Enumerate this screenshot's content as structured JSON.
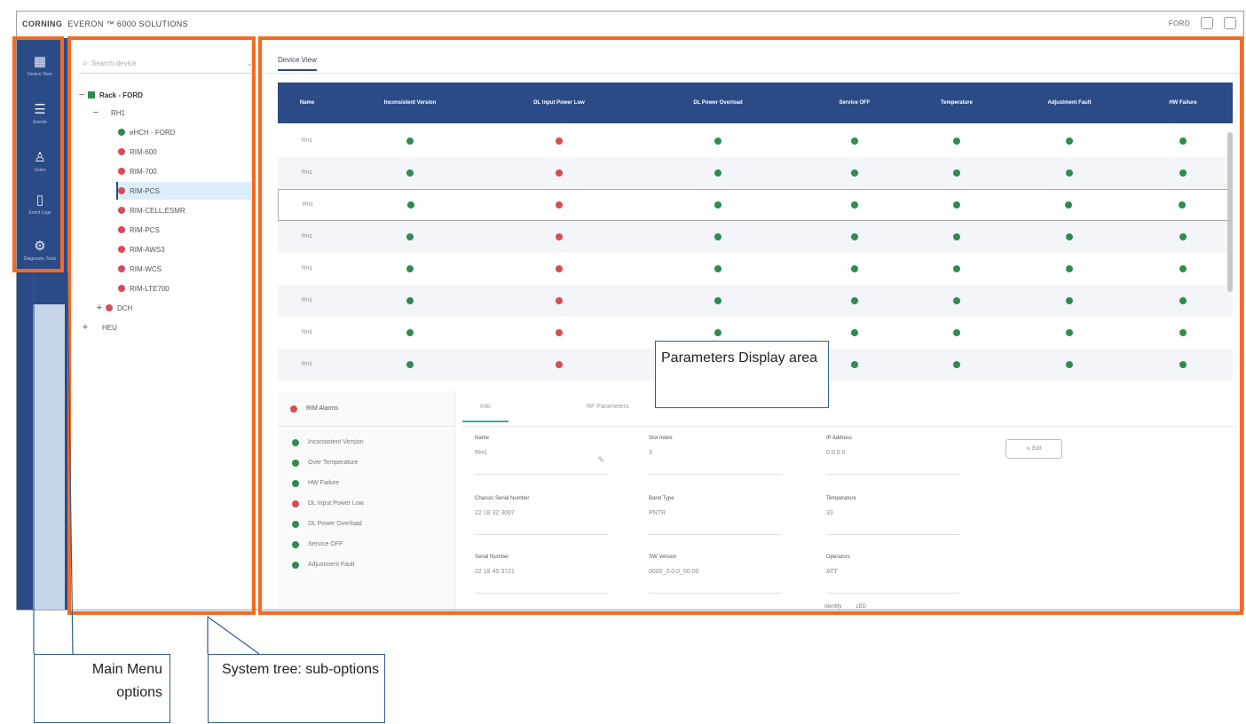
{
  "header": {
    "brand": "CORNING",
    "product": "EVERON ™ 6000 SOLUTIONS",
    "user": "FORD"
  },
  "menu": {
    "items": [
      {
        "label": "Device View",
        "icon": "grid-icon"
      },
      {
        "label": "Events",
        "icon": "list-icon"
      },
      {
        "label": "Users",
        "icon": "user-icon"
      },
      {
        "label": "Event Logs",
        "icon": "clipboard-icon"
      },
      {
        "label": "Diagnostic Tools",
        "icon": "gear-icon"
      }
    ]
  },
  "tree": {
    "search_placeholder": "Search device",
    "root": "Rack - FORD",
    "group": "RH1",
    "nodes": [
      {
        "label": "eHCH - FORD",
        "status": "ok"
      },
      {
        "label": "RIM-600",
        "status": "alarm"
      },
      {
        "label": "RIM-700",
        "status": "alarm"
      },
      {
        "label": "RIM-PCS",
        "status": "alarm"
      },
      {
        "label": "RIM-CELL,ESMR",
        "status": "alarm"
      },
      {
        "label": "RIM-PCS",
        "status": "alarm"
      },
      {
        "label": "RIM-AWS3",
        "status": "alarm"
      },
      {
        "label": "RIM-WCS",
        "status": "alarm"
      },
      {
        "label": "RIM-LTE700",
        "status": "alarm"
      }
    ],
    "dch": "DCH",
    "heu": "HEU"
  },
  "main": {
    "tab": "Device View",
    "columns": [
      "Name",
      "Inconsistent Version",
      "DL Input Power Low",
      "DL Power Overload",
      "Service OFF",
      "Temperature",
      "Adjustment Fault",
      "HW Failure"
    ],
    "rows": [
      {
        "name": "RH1",
        "status": [
          "ok",
          "alarm",
          "ok",
          "ok",
          "ok",
          "ok",
          "ok"
        ]
      },
      {
        "name": "RH1",
        "status": [
          "ok",
          "alarm",
          "ok",
          "ok",
          "ok",
          "ok",
          "ok"
        ]
      },
      {
        "name": "RH1",
        "status": [
          "ok",
          "alarm",
          "ok",
          "ok",
          "ok",
          "ok",
          "ok"
        ]
      },
      {
        "name": "RH1",
        "status": [
          "ok",
          "alarm",
          "ok",
          "ok",
          "ok",
          "ok",
          "ok"
        ]
      },
      {
        "name": "RH1",
        "status": [
          "ok",
          "alarm",
          "ok",
          "ok",
          "ok",
          "ok",
          "ok"
        ]
      },
      {
        "name": "RH1",
        "status": [
          "ok",
          "alarm",
          "ok",
          "ok",
          "ok",
          "ok",
          "ok"
        ]
      },
      {
        "name": "RH1",
        "status": [
          "ok",
          "alarm",
          "ok",
          "ok",
          "ok",
          "ok",
          "ok"
        ]
      },
      {
        "name": "RH1",
        "status": [
          "ok",
          "alarm",
          "ok",
          "ok",
          "ok",
          "ok",
          "ok"
        ]
      }
    ]
  },
  "alarms": {
    "title": "RIM Alarms",
    "items": [
      {
        "label": "Inconsistent Version",
        "status": "ok"
      },
      {
        "label": "Over Temperature",
        "status": "ok"
      },
      {
        "label": "HW Failure",
        "status": "ok"
      },
      {
        "label": "DL Input Power Low",
        "status": "alarm"
      },
      {
        "label": "DL Power Overload",
        "status": "ok"
      },
      {
        "label": "Service OFF",
        "status": "ok"
      },
      {
        "label": "Adjustment Fault",
        "status": "ok"
      }
    ]
  },
  "details": {
    "tabs": [
      "Info",
      "RF Parameters"
    ],
    "edit": "Edit",
    "fields": {
      "name_label": "Name",
      "name_value": "RH1",
      "slot_label": "Slot Index",
      "slot_value": "3",
      "ip_label": "IP Address",
      "ip_value": "0.0.0.0",
      "chassis_label": "Chassis Serial Number",
      "chassis_value": "22 18 32 3007",
      "band_label": "Band Type",
      "band_value": "PNTR",
      "temp_label": "Temperature",
      "temp_value": "33",
      "serial_label": "Serial Number",
      "serial_value": "22 18 45 3721",
      "sw_label": "SW Version",
      "sw_value": "0000_0.0.0_00.00",
      "operators_label": "Operators",
      "operators_value": "ATT",
      "identify_label": "Identify",
      "identify_value": "LED"
    }
  },
  "callouts": {
    "params": "Parameters Display area",
    "menu": "Main Menu options",
    "tree": "System tree: sub-options"
  },
  "colors": {
    "navy": "#2b4b86",
    "ok": "#2e8b57",
    "alarm": "#d94a5a",
    "highlight": "#f46a24"
  }
}
